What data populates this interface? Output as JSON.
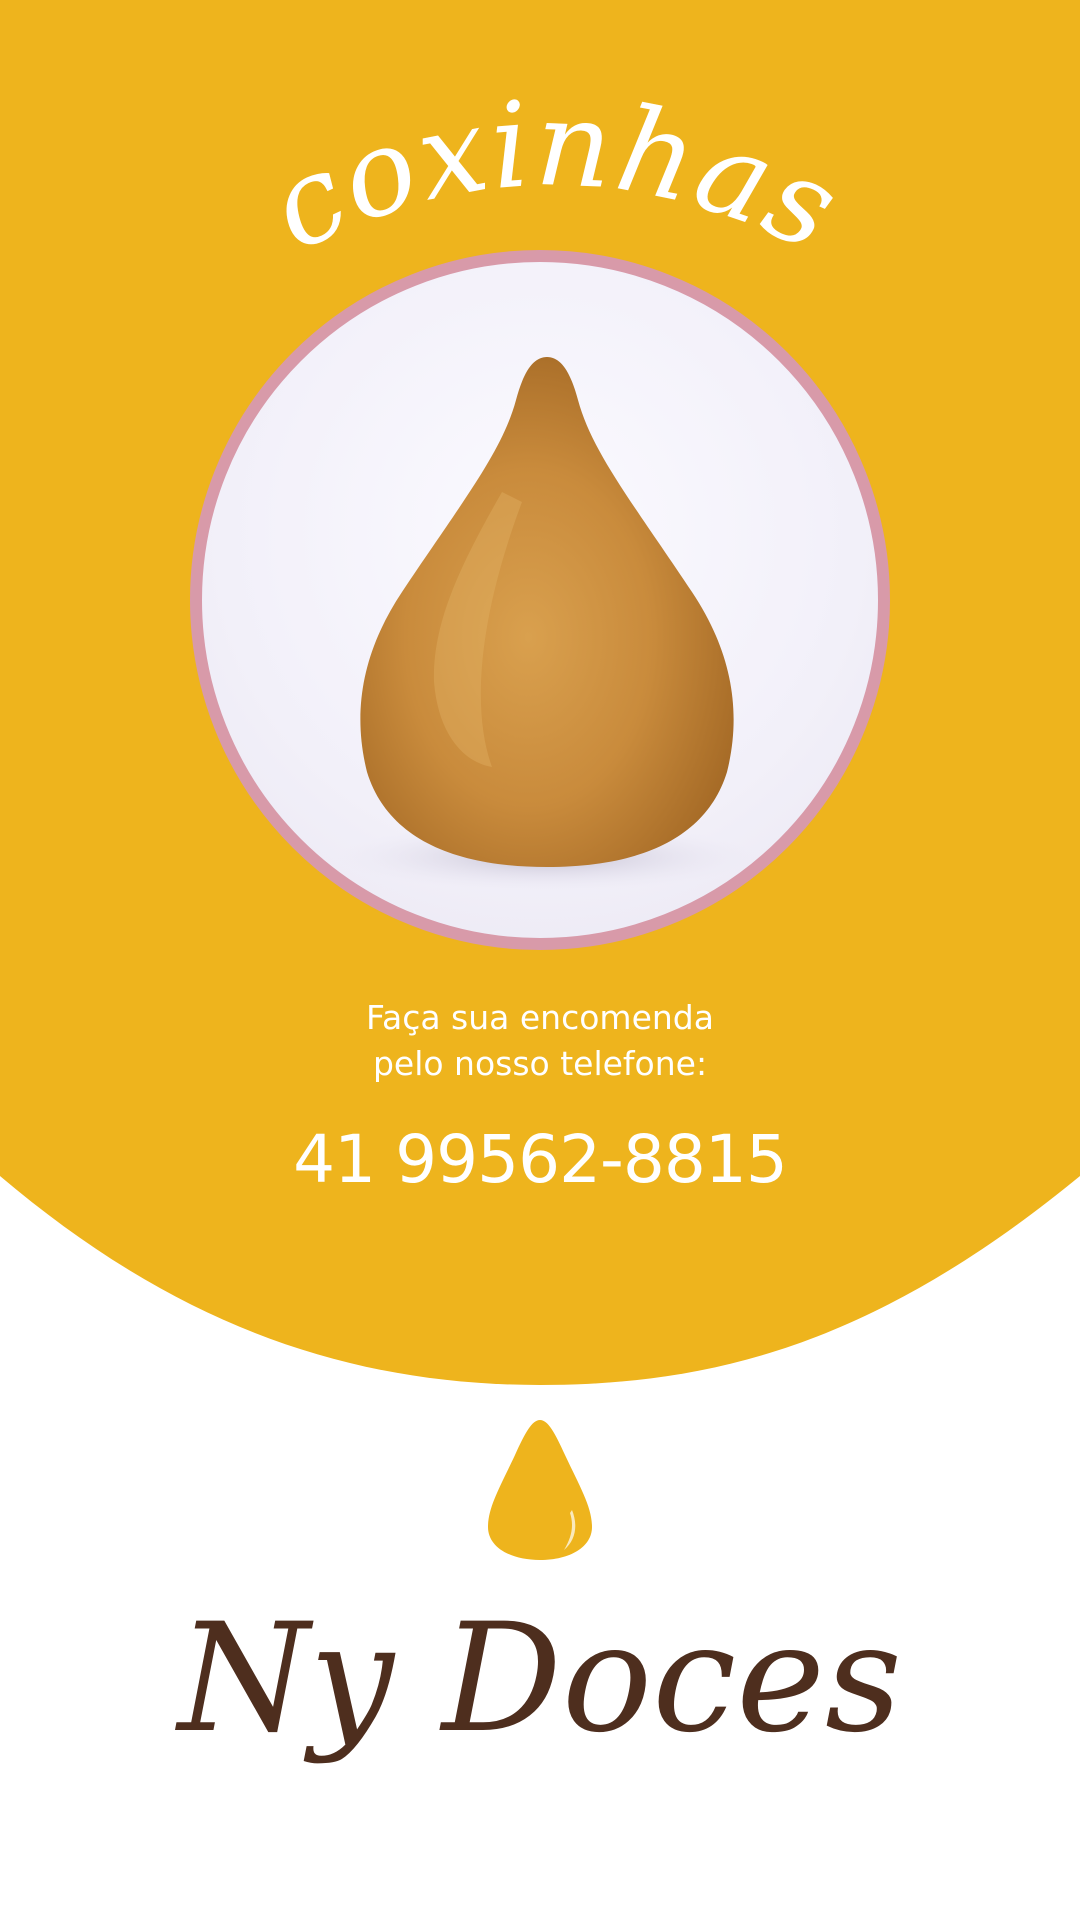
{
  "colors": {
    "primary_yellow": "#EEB41D",
    "frame_pink": "#D89AA9",
    "brand_brown": "#4E2E1E",
    "white": "#FFFFFF"
  },
  "header": {
    "title": "coxinhas"
  },
  "hero": {
    "image_subject": "coxinha"
  },
  "order": {
    "line1": "Faça sua encomenda",
    "line2": "pelo nosso telefone:",
    "phone": "41 99562-8815"
  },
  "brand": {
    "icon": "drop-icon",
    "name": "Ny Doces"
  }
}
